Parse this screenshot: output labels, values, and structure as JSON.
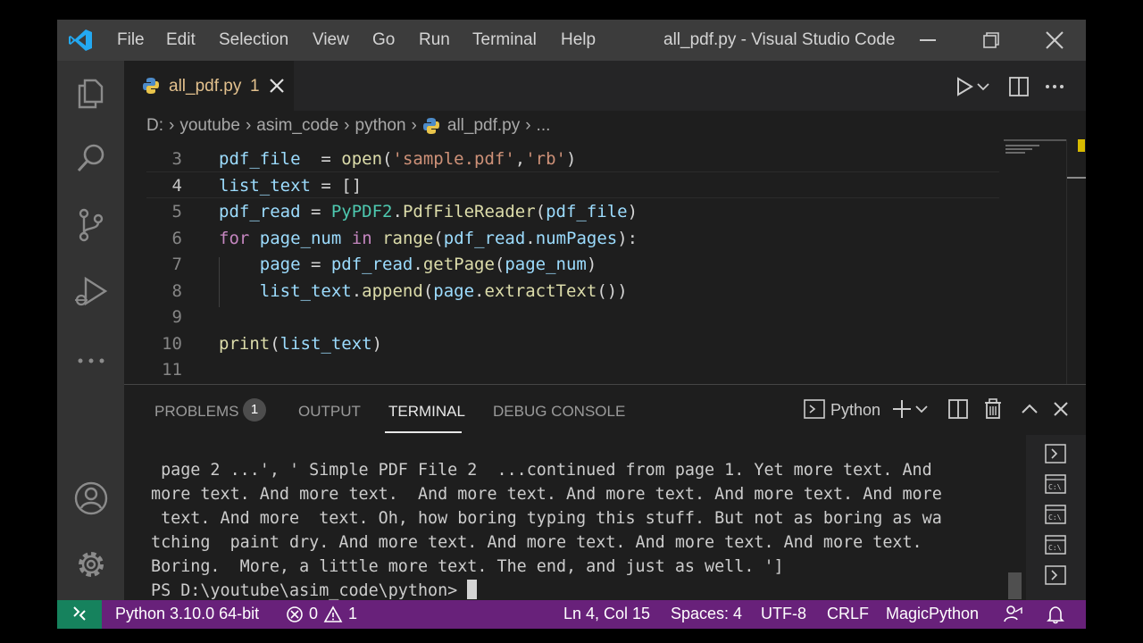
{
  "app": {
    "window_title": "all_pdf.py - Visual Studio Code",
    "menu": [
      "File",
      "Edit",
      "Selection",
      "View",
      "Go",
      "Run",
      "Terminal",
      "Help"
    ]
  },
  "activity_bar": [
    "explorer-icon",
    "search-icon",
    "source-control-icon",
    "run-debug-icon",
    "more-icon",
    "account-icon",
    "settings-icon"
  ],
  "editor": {
    "tab": {
      "label": "all_pdf.py",
      "problems": "1"
    },
    "breadcrumb": [
      "D:",
      "youtube",
      "asim_code",
      "python",
      "all_pdf.py",
      "..."
    ],
    "current_line": "4",
    "lines": [
      {
        "num": "3",
        "text": "pdf_file  = open('sample.pdf','rb')"
      },
      {
        "num": "4",
        "text": "list_text = []"
      },
      {
        "num": "5",
        "text": "pdf_read = PyPDF2.PdfFileReader(pdf_file)"
      },
      {
        "num": "6",
        "text": "for page_num in range(pdf_read.numPages):"
      },
      {
        "num": "7",
        "text": "    page = pdf_read.getPage(page_num)"
      },
      {
        "num": "8",
        "text": "    list_text.append(page.extractText())"
      },
      {
        "num": "9",
        "text": ""
      },
      {
        "num": "10",
        "text": "print(list_text)"
      },
      {
        "num": "11",
        "text": ""
      }
    ]
  },
  "panel": {
    "tabs": {
      "problems": "PROBLEMS",
      "output": "OUTPUT",
      "terminal": "TERMINAL",
      "debug": "DEBUG CONSOLE"
    },
    "problems_count": "1",
    "active_tab": "TERMINAL",
    "terminal_name": "Python",
    "terminal_lines": [
      " page 2 ...', ' Simple PDF File 2  ...continued from page 1. Yet more text. And",
      "more text. And more text.  And more text. And more text. And more text. And more",
      " text. And more  text. Oh, how boring typing this stuff. But not as boring as wa",
      "tching  paint dry. And more text. And more text. And more text. And more text.",
      "Boring.  More, a little more text. The end, and just as well. ']"
    ],
    "prompt": "PS D:\\youtube\\asim_code\\python> "
  },
  "status_bar": {
    "interpreter": "Python 3.10.0 64-bit",
    "errors": "0",
    "warnings": "1",
    "position": "Ln 4, Col 15",
    "spaces": "Spaces: 4",
    "encoding": "UTF-8",
    "eol": "CRLF",
    "language": "MagicPython"
  },
  "colors": {
    "status_bar": "#68217a",
    "remote": "#16825d",
    "title_bar": "#3c3c3c",
    "editor_bg": "#1e1e1e",
    "activity_bar": "#333333"
  }
}
